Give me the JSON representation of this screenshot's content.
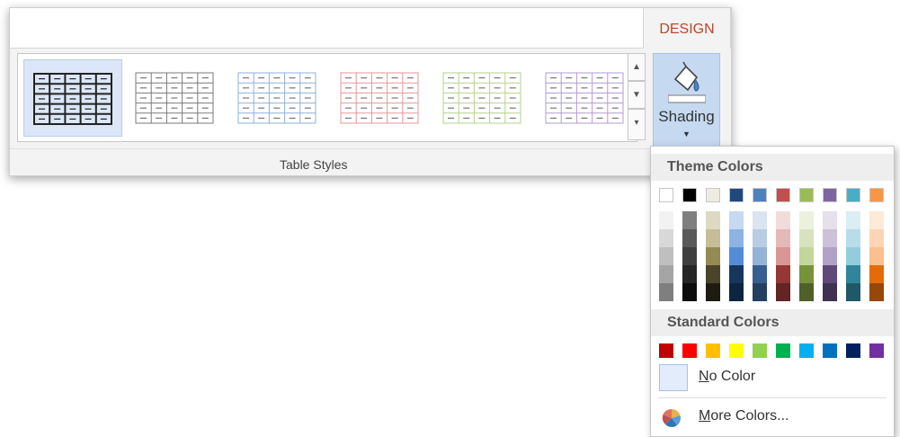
{
  "ribbon": {
    "tab_label": "DESIGN",
    "group_label": "Table Styles",
    "shading_label": "Shading",
    "styles": [
      {
        "name": "plain-table",
        "line_color": "#222222",
        "selected": true
      },
      {
        "name": "table-grid-light",
        "line_color": "#7a7a7a",
        "selected": false
      },
      {
        "name": "grid-blue",
        "line_color": "#8fb0dc",
        "selected": false
      },
      {
        "name": "grid-red",
        "line_color": "#e39a9a",
        "selected": false
      },
      {
        "name": "grid-green",
        "line_color": "#b6d28d",
        "selected": false
      },
      {
        "name": "grid-purple",
        "line_color": "#b29cd0",
        "selected": false
      }
    ],
    "scroll_icons": [
      "scroll-up-icon",
      "scroll-down-icon",
      "more-icon"
    ]
  },
  "menu": {
    "theme_header": "Theme Colors",
    "standard_header": "Standard Colors",
    "theme_top": [
      "#ffffff",
      "#000000",
      "#eeece1",
      "#1f497d",
      "#4f81bd",
      "#c0504d",
      "#9bbb59",
      "#8064a2",
      "#4bacc6",
      "#f79646"
    ],
    "theme_shades": [
      [
        "#f2f2f2",
        "#d8d8d8",
        "#bfbfbf",
        "#a5a5a5",
        "#7f7f7f"
      ],
      [
        "#7f7f7f",
        "#595959",
        "#3f3f3f",
        "#262626",
        "#0c0c0c"
      ],
      [
        "#ddd9c3",
        "#c4bd97",
        "#948a54",
        "#4a452a",
        "#1e1c11"
      ],
      [
        "#c6d9f0",
        "#8db3e2",
        "#548dd4",
        "#17365d",
        "#0f243e"
      ],
      [
        "#dbe5f1",
        "#b8cce4",
        "#95b3d7",
        "#366092",
        "#244061"
      ],
      [
        "#f2dcdb",
        "#e5b9b7",
        "#d99694",
        "#953734",
        "#632423"
      ],
      [
        "#ebf1dd",
        "#d7e3bc",
        "#c3d69b",
        "#76923c",
        "#4f6128"
      ],
      [
        "#e5e0ec",
        "#ccc1d9",
        "#b2a2c7",
        "#5f497a",
        "#3f3151"
      ],
      [
        "#dbeef3",
        "#b7dde8",
        "#92cddc",
        "#31859b",
        "#205867"
      ],
      [
        "#fdeada",
        "#fbd5b5",
        "#fac08f",
        "#e36c09",
        "#974806"
      ]
    ],
    "standard": [
      "#c00000",
      "#ff0000",
      "#ffc000",
      "#ffff00",
      "#92d050",
      "#00b050",
      "#00b0f0",
      "#0070c0",
      "#002060",
      "#7030a0"
    ],
    "no_color": {
      "accel": "N",
      "rest": "o Color"
    },
    "more_colors": {
      "accel": "M",
      "rest": "ore Colors..."
    },
    "icons": [
      "paint-bucket-icon",
      "dropdown-caret-icon",
      "color-wheel-icon"
    ]
  }
}
